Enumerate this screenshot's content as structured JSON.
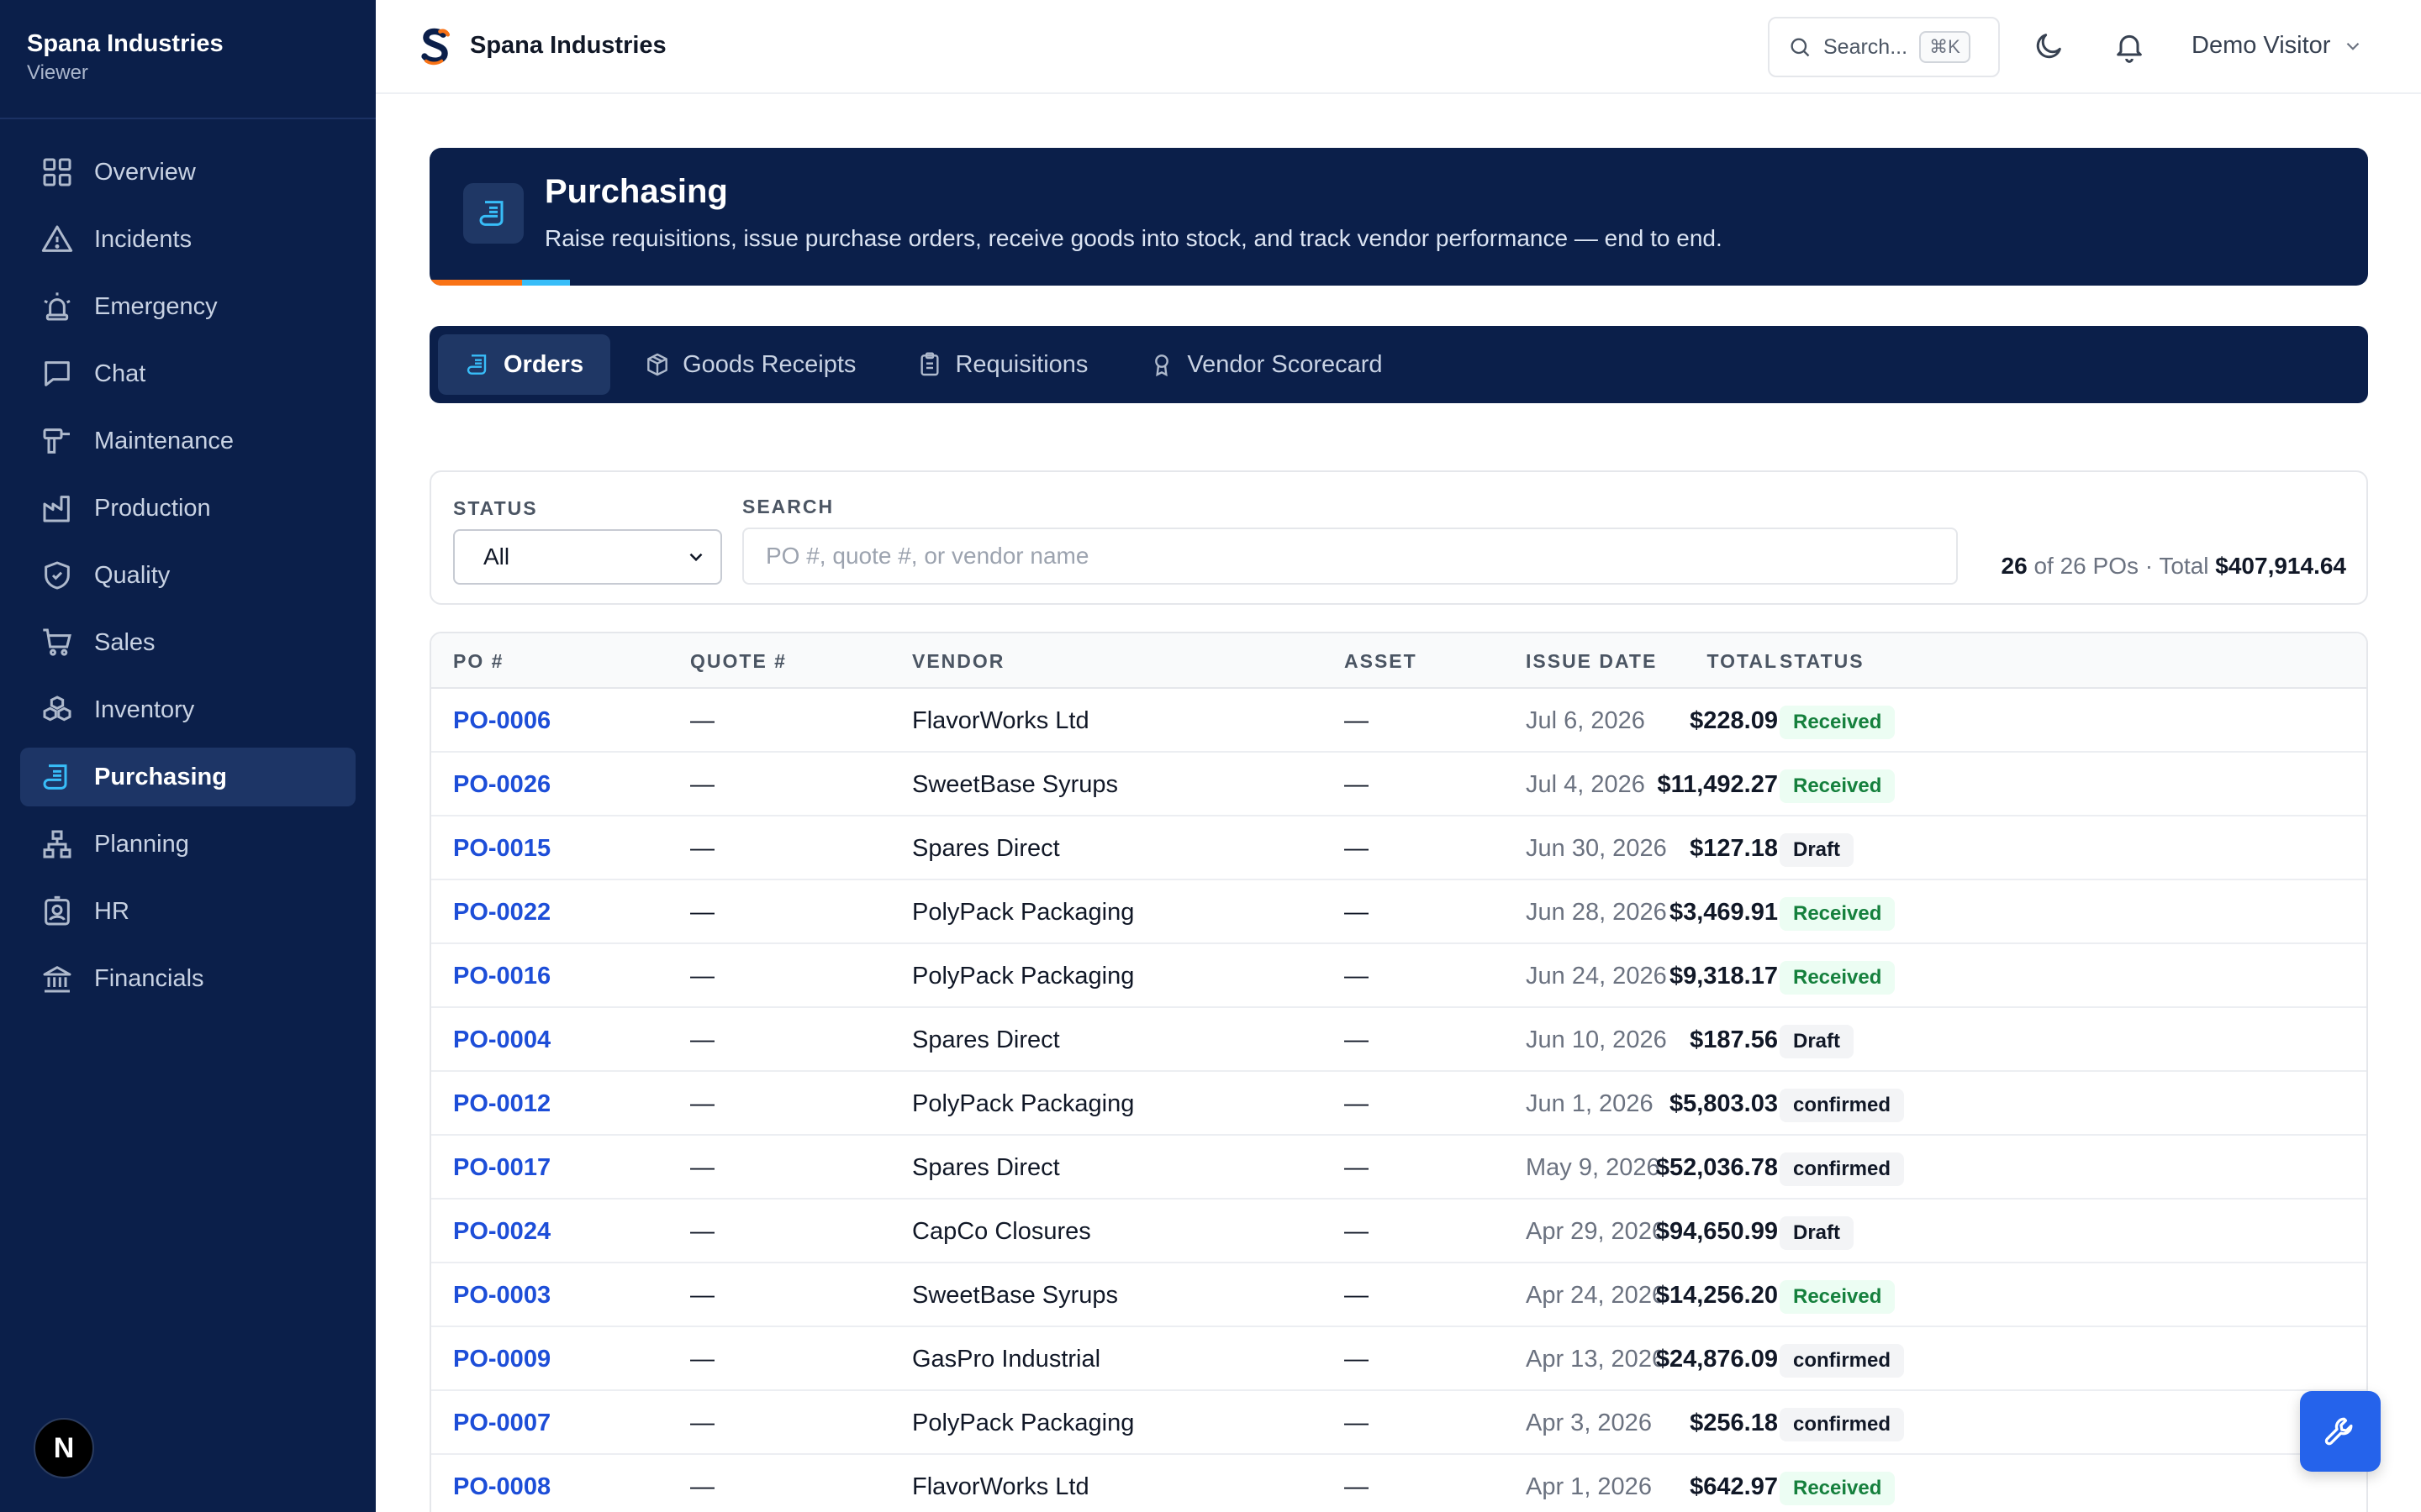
{
  "sidebar": {
    "company": "Spana Industries",
    "role": "Viewer",
    "items": [
      {
        "label": "Overview",
        "icon": "grid-icon"
      },
      {
        "label": "Incidents",
        "icon": "warning-triangle-icon"
      },
      {
        "label": "Emergency",
        "icon": "siren-icon"
      },
      {
        "label": "Chat",
        "icon": "chat-bubble-icon"
      },
      {
        "label": "Maintenance",
        "icon": "drill-icon"
      },
      {
        "label": "Production",
        "icon": "factory-icon"
      },
      {
        "label": "Quality",
        "icon": "shield-check-icon"
      },
      {
        "label": "Sales",
        "icon": "cart-icon"
      },
      {
        "label": "Inventory",
        "icon": "boxes-icon"
      },
      {
        "label": "Purchasing",
        "icon": "scroll-icon",
        "active": true
      },
      {
        "label": "Planning",
        "icon": "org-chart-icon"
      },
      {
        "label": "HR",
        "icon": "id-badge-icon"
      },
      {
        "label": "Financials",
        "icon": "bank-icon"
      }
    ],
    "bottom_badge": "N"
  },
  "topbar": {
    "title": "Spana Industries",
    "search_placeholder": "Search...",
    "search_shortcut": "⌘K",
    "user_name": "Demo Visitor"
  },
  "banner": {
    "title": "Purchasing",
    "subtitle": "Raise requisitions, issue purchase orders, receive goods into stock, and track vendor performance — end to end."
  },
  "tabs": [
    {
      "label": "Orders",
      "icon": "scroll-icon",
      "active": true
    },
    {
      "label": "Goods Receipts",
      "icon": "package-icon"
    },
    {
      "label": "Requisitions",
      "icon": "clipboard-icon"
    },
    {
      "label": "Vendor Scorecard",
      "icon": "award-icon"
    }
  ],
  "filters": {
    "status_label": "STATUS",
    "status_value": "All",
    "search_label": "SEARCH",
    "search_placeholder": "PO #, quote #, or vendor name",
    "count_shown": "26",
    "count_text": "of 26 POs · Total",
    "total": "$407,914.64"
  },
  "table": {
    "columns": [
      "PO #",
      "QUOTE #",
      "VENDOR",
      "ASSET",
      "ISSUE DATE",
      "TOTAL",
      "STATUS"
    ],
    "rows": [
      {
        "po": "PO-0006",
        "quote": "—",
        "vendor": "FlavorWorks Ltd",
        "asset": "—",
        "date": "Jul 6, 2026",
        "total": "$228.09",
        "status": "Received"
      },
      {
        "po": "PO-0026",
        "quote": "—",
        "vendor": "SweetBase Syrups",
        "asset": "—",
        "date": "Jul 4, 2026",
        "total": "$11,492.27",
        "status": "Received"
      },
      {
        "po": "PO-0015",
        "quote": "—",
        "vendor": "Spares Direct",
        "asset": "—",
        "date": "Jun 30, 2026",
        "total": "$127.18",
        "status": "Draft"
      },
      {
        "po": "PO-0022",
        "quote": "—",
        "vendor": "PolyPack Packaging",
        "asset": "—",
        "date": "Jun 28, 2026",
        "total": "$3,469.91",
        "status": "Received"
      },
      {
        "po": "PO-0016",
        "quote": "—",
        "vendor": "PolyPack Packaging",
        "asset": "—",
        "date": "Jun 24, 2026",
        "total": "$9,318.17",
        "status": "Received"
      },
      {
        "po": "PO-0004",
        "quote": "—",
        "vendor": "Spares Direct",
        "asset": "—",
        "date": "Jun 10, 2026",
        "total": "$187.56",
        "status": "Draft"
      },
      {
        "po": "PO-0012",
        "quote": "—",
        "vendor": "PolyPack Packaging",
        "asset": "—",
        "date": "Jun 1, 2026",
        "total": "$5,803.03",
        "status": "confirmed"
      },
      {
        "po": "PO-0017",
        "quote": "—",
        "vendor": "Spares Direct",
        "asset": "—",
        "date": "May 9, 2026",
        "total": "$52,036.78",
        "status": "confirmed"
      },
      {
        "po": "PO-0024",
        "quote": "—",
        "vendor": "CapCo Closures",
        "asset": "—",
        "date": "Apr 29, 2026",
        "total": "$94,650.99",
        "status": "Draft"
      },
      {
        "po": "PO-0003",
        "quote": "—",
        "vendor": "SweetBase Syrups",
        "asset": "—",
        "date": "Apr 24, 2026",
        "total": "$14,256.20",
        "status": "Received"
      },
      {
        "po": "PO-0009",
        "quote": "—",
        "vendor": "GasPro Industrial",
        "asset": "—",
        "date": "Apr 13, 2026",
        "total": "$24,876.09",
        "status": "confirmed"
      },
      {
        "po": "PO-0007",
        "quote": "—",
        "vendor": "PolyPack Packaging",
        "asset": "—",
        "date": "Apr 3, 2026",
        "total": "$256.18",
        "status": "confirmed"
      },
      {
        "po": "PO-0008",
        "quote": "—",
        "vendor": "FlavorWorks Ltd",
        "asset": "—",
        "date": "Apr 1, 2026",
        "total": "$642.97",
        "status": "Received"
      }
    ]
  },
  "status_colors": {
    "Received": {
      "bg": "#ecfdf3",
      "fg": "#15803d"
    },
    "Draft": {
      "bg": "#f3f4f6",
      "fg": "#111827"
    },
    "confirmed": {
      "bg": "#f3f4f6",
      "fg": "#111827"
    }
  },
  "colors": {
    "navy": "#0b1f4a",
    "accent_blue": "#38bdf8",
    "accent_orange": "#f97316",
    "link_blue": "#1d4ed8",
    "fab_blue": "#2563eb"
  },
  "fab": {
    "icon": "wrench-icon"
  }
}
